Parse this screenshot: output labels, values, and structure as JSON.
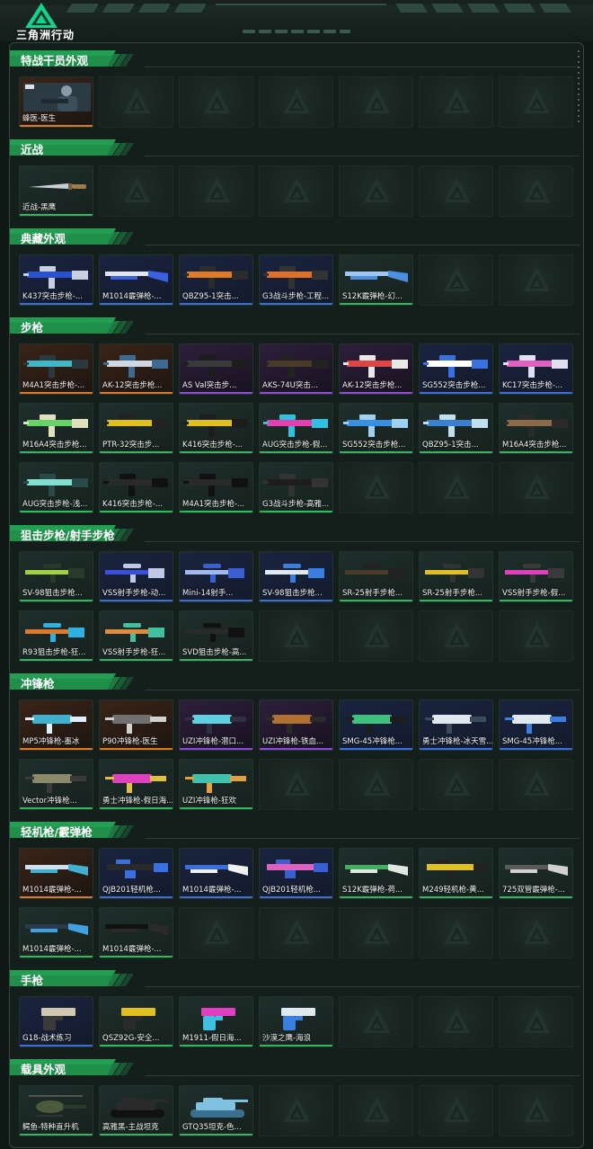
{
  "header": {
    "logo_text": "三角洲行动"
  },
  "colors": {
    "blue": "#3e6fd6",
    "green": "#2fb85c",
    "orange": "#d97a2a",
    "purple": "#8e4fd3",
    "accent": "#1f8f4a"
  },
  "sections": [
    {
      "title": "特战干员外观",
      "items": [
        {
          "name": "蜂医-医生",
          "rarity": "orange",
          "kind": "operator"
        },
        null,
        null,
        null,
        null,
        null,
        null
      ]
    },
    {
      "title": "近战",
      "items": [
        {
          "name": "近战-黑鹰",
          "rarity": "green",
          "kind": "knife"
        },
        null,
        null,
        null,
        null,
        null,
        null
      ]
    },
    {
      "title": "典藏外观",
      "items": [
        {
          "name": "K437突击步枪-...",
          "rarity": "blue",
          "kind": "rifle",
          "c1": "#2b4fd1",
          "c2": "#c8d0e0"
        },
        {
          "name": "M1014霰弹枪-...",
          "rarity": "blue",
          "kind": "shotgun",
          "c1": "#3a5fe0",
          "c2": "#dfe6f2"
        },
        {
          "name": "QBZ95-1突击...",
          "rarity": "blue",
          "kind": "rifle",
          "c1": "#e07a2b",
          "c2": "#2c2c2c"
        },
        {
          "name": "G3战斗步枪-工程...",
          "rarity": "blue",
          "kind": "rifle",
          "c1": "#e06f2a",
          "c2": "#333"
        },
        {
          "name": "S12K霰弹枪-幻...",
          "rarity": "green",
          "kind": "shotgun",
          "c1": "#4a8fe0",
          "c2": "#9fc6f2"
        },
        null,
        null
      ]
    },
    {
      "title": "步枪",
      "items": [
        {
          "name": "M4A1突击步枪-...",
          "rarity": "orange",
          "kind": "rifle",
          "c1": "#3fb7c7",
          "c2": "#2c3a3f"
        },
        {
          "name": "AK-12突击步枪...",
          "rarity": "orange",
          "kind": "rifle",
          "c1": "#cfd8e0",
          "c2": "#3d6b8f"
        },
        {
          "name": "AS Val突击步...",
          "rarity": "purple",
          "kind": "rifle",
          "c1": "#3a3a3a",
          "c2": "#1d1d1d"
        },
        {
          "name": "AKS-74U突击...",
          "rarity": "purple",
          "kind": "rifle",
          "c1": "#4a3a2a",
          "c2": "#222"
        },
        {
          "name": "AK-12突击步枪...",
          "rarity": "purple",
          "kind": "rifle",
          "c1": "#e04545",
          "c2": "#e8e8e8"
        },
        {
          "name": "SG552突击步枪...",
          "rarity": "blue",
          "kind": "rifle",
          "c1": "#ffffff",
          "c2": "#3a6fe0"
        },
        {
          "name": "KC17突击步枪-...",
          "rarity": "blue",
          "kind": "rifle",
          "c1": "#e060c0",
          "c2": "#e0e0f0"
        },
        {
          "name": "M16A4突击步枪...",
          "rarity": "green",
          "kind": "rifle",
          "c1": "#6ad06a",
          "c2": "#e0e0c0"
        },
        {
          "name": "PTR-32突击步...",
          "rarity": "green",
          "kind": "rifle",
          "c1": "#e0c020",
          "c2": "#222"
        },
        {
          "name": "K416突击步枪-...",
          "rarity": "green",
          "kind": "rifle",
          "c1": "#e0c020",
          "c2": "#1d1d1d"
        },
        {
          "name": "AUG突击步枪-假...",
          "rarity": "green",
          "kind": "rifle",
          "c1": "#e040b0",
          "c2": "#30c0e0"
        },
        {
          "name": "SG552突击步枪...",
          "rarity": "green",
          "kind": "rifle",
          "c1": "#3a8fe0",
          "c2": "#a0d0f0"
        },
        {
          "name": "QBZ95-1突击...",
          "rarity": "green",
          "kind": "rifle",
          "c1": "#3a7fd0",
          "c2": "#c0e0f0"
        },
        {
          "name": "M16A4突击步枪...",
          "rarity": "green",
          "kind": "rifle",
          "c1": "#8a6a4a",
          "c2": "#2a2a2a"
        },
        {
          "name": "AUG突击步枪-浅...",
          "rarity": "green",
          "kind": "rifle",
          "c1": "#7fe0d0",
          "c2": "#2a4a4a"
        },
        {
          "name": "K416突击步枪-...",
          "rarity": "green",
          "kind": "rifle",
          "c1": "#2a2a2a",
          "c2": "#111"
        },
        {
          "name": "M4A1突击步枪-...",
          "rarity": "green",
          "kind": "rifle",
          "c1": "#2a2a2a",
          "c2": "#111"
        },
        {
          "name": "G3战斗步枪-高雅...",
          "rarity": "green",
          "kind": "rifle",
          "c1": "#1d1d1d",
          "c2": "#333"
        },
        null,
        null,
        null
      ]
    },
    {
      "title": "狙击步枪/射手步枪",
      "items": [
        {
          "name": "SV-98狙击步枪...",
          "rarity": "green",
          "kind": "sniper",
          "c1": "#a0d040",
          "c2": "#2a3a2a"
        },
        {
          "name": "VSS射手步枪-动...",
          "rarity": "blue",
          "kind": "sniper",
          "c1": "#3a4fe0",
          "c2": "#c0c8e8"
        },
        {
          "name": "Mini-14射手...",
          "rarity": "blue",
          "kind": "sniper",
          "c1": "#a0b8f0",
          "c2": "#3a5fd0"
        },
        {
          "name": "SV-98狙击步枪...",
          "rarity": "blue",
          "kind": "sniper",
          "c1": "#e0e8f0",
          "c2": "#3a7fe0"
        },
        {
          "name": "SR-25射手步枪...",
          "rarity": "green",
          "kind": "sniper",
          "c1": "#4a3a2a",
          "c2": "#222"
        },
        {
          "name": "SR-25射手步枪...",
          "rarity": "green",
          "kind": "sniper",
          "c1": "#e0c020",
          "c2": "#333"
        },
        {
          "name": "VSS射手步枪-假...",
          "rarity": "green",
          "kind": "sniper",
          "c1": "#e040c0",
          "c2": "#3a3a3a"
        },
        {
          "name": "R93狙击步枪-狂...",
          "rarity": "green",
          "kind": "sniper",
          "c1": "#e07a2b",
          "c2": "#30b0e0"
        },
        {
          "name": "VSS射手步枪-狂...",
          "rarity": "green",
          "kind": "sniper",
          "c1": "#e08a3b",
          "c2": "#40c0a0"
        },
        {
          "name": "SVD狙击步枪-高...",
          "rarity": "green",
          "kind": "sniper",
          "c1": "#2a2a2a",
          "c2": "#111"
        },
        null,
        null,
        null,
        null
      ]
    },
    {
      "title": "冲锋枪",
      "items": [
        {
          "name": "MP5冲锋枪-墨冰",
          "rarity": "orange",
          "kind": "smg",
          "c1": "#40b0d0",
          "c2": "#e0f0f8"
        },
        {
          "name": "P90冲锋枪-医生",
          "rarity": "orange",
          "kind": "smg",
          "c1": "#707070",
          "c2": "#d0d0d0"
        },
        {
          "name": "UZI冲锋枪-潜口...",
          "rarity": "purple",
          "kind": "smg",
          "c1": "#60d0e0",
          "c2": "#303040"
        },
        {
          "name": "UZI冲锋枪-铁血...",
          "rarity": "purple",
          "kind": "smg",
          "c1": "#b07030",
          "c2": "#2a2a2a"
        },
        {
          "name": "SMG-45冲锋枪...",
          "rarity": "blue",
          "kind": "smg",
          "c1": "#40c080",
          "c2": "#1d1d1d"
        },
        {
          "name": "勇士冲锋枪-冰天雪...",
          "rarity": "blue",
          "kind": "smg",
          "c1": "#e0e8f0",
          "c2": "#3a4a5a"
        },
        {
          "name": "SMG-45冲锋枪...",
          "rarity": "blue",
          "kind": "smg",
          "c1": "#e0e8f0",
          "c2": "#3a7fe0"
        },
        {
          "name": "Vector冲锋枪...",
          "rarity": "green",
          "kind": "smg",
          "c1": "#8a8a6a",
          "c2": "#3a3a3a"
        },
        {
          "name": "勇士冲锋枪-假日海...",
          "rarity": "green",
          "kind": "smg",
          "c1": "#e040c0",
          "c2": "#e0c040"
        },
        {
          "name": "UZI冲锋枪-狂欢",
          "rarity": "green",
          "kind": "smg",
          "c1": "#40c0b0",
          "c2": "#e0a040"
        },
        null,
        null,
        null,
        null
      ]
    },
    {
      "title": "轻机枪/霰弹枪",
      "items": [
        {
          "name": "M1014霰弹枪-...",
          "rarity": "orange",
          "kind": "shotgun",
          "c1": "#40b0d0",
          "c2": "#d0e0f0"
        },
        {
          "name": "QJB201轻机枪...",
          "rarity": "blue",
          "kind": "lmg",
          "c1": "#2a2a2a",
          "c2": "#3a6fe0"
        },
        {
          "name": "M1014霰弹枪-...",
          "rarity": "blue",
          "kind": "shotgun",
          "c1": "#f0f0f0",
          "c2": "#3a6fe0"
        },
        {
          "name": "QJB201轻机枪...",
          "rarity": "blue",
          "kind": "lmg",
          "c1": "#e060c0",
          "c2": "#3a5fd0"
        },
        {
          "name": "S12K霰弹枪-荷...",
          "rarity": "green",
          "kind": "shotgun",
          "c1": "#e0e8e0",
          "c2": "#40b060"
        },
        {
          "name": "M249轻机枪-黄...",
          "rarity": "green",
          "kind": "lmg",
          "c1": "#e0c020",
          "c2": "#222"
        },
        {
          "name": "725双管霰弹枪-...",
          "rarity": "green",
          "kind": "shotgun",
          "c1": "#d0d0d0",
          "c2": "#5a5a5a"
        },
        {
          "name": "M1014霰弹枪-...",
          "rarity": "green",
          "kind": "shotgun",
          "c1": "#40a0e0",
          "c2": "#2a3a4a"
        },
        {
          "name": "M1014霰弹枪-...",
          "rarity": "green",
          "kind": "shotgun",
          "c1": "#2a2a2a",
          "c2": "#111"
        },
        null,
        null,
        null,
        null,
        null
      ]
    },
    {
      "title": "手枪",
      "items": [
        {
          "name": "G18-战术练习",
          "rarity": "blue",
          "kind": "pistol",
          "c1": "#d0c8b0",
          "c2": "#3a3a3a"
        },
        {
          "name": "QSZ92G-安全...",
          "rarity": "green",
          "kind": "pistol",
          "c1": "#e0c020",
          "c2": "#2a2a2a"
        },
        {
          "name": "M1911-假日海...",
          "rarity": "green",
          "kind": "pistol",
          "c1": "#e040c0",
          "c2": "#40c0e0"
        },
        {
          "name": "沙漠之鹰-海浪",
          "rarity": "green",
          "kind": "pistol",
          "c1": "#e0e8f0",
          "c2": "#3a7fe0"
        },
        null,
        null,
        null
      ]
    },
    {
      "title": "载具外观",
      "items": [
        {
          "name": "鳄鱼-特种直升机",
          "rarity": "green",
          "kind": "heli",
          "c1": "#4a5a3a",
          "c2": "#2a3a2a"
        },
        {
          "name": "高雅黑-主战坦克",
          "rarity": "green",
          "kind": "tank",
          "c1": "#2a2a2a",
          "c2": "#111"
        },
        {
          "name": "GTQ35坦克-色...",
          "rarity": "green",
          "kind": "tank",
          "c1": "#80c0e0",
          "c2": "#3a6f8f"
        },
        null,
        null,
        null,
        null
      ]
    }
  ]
}
